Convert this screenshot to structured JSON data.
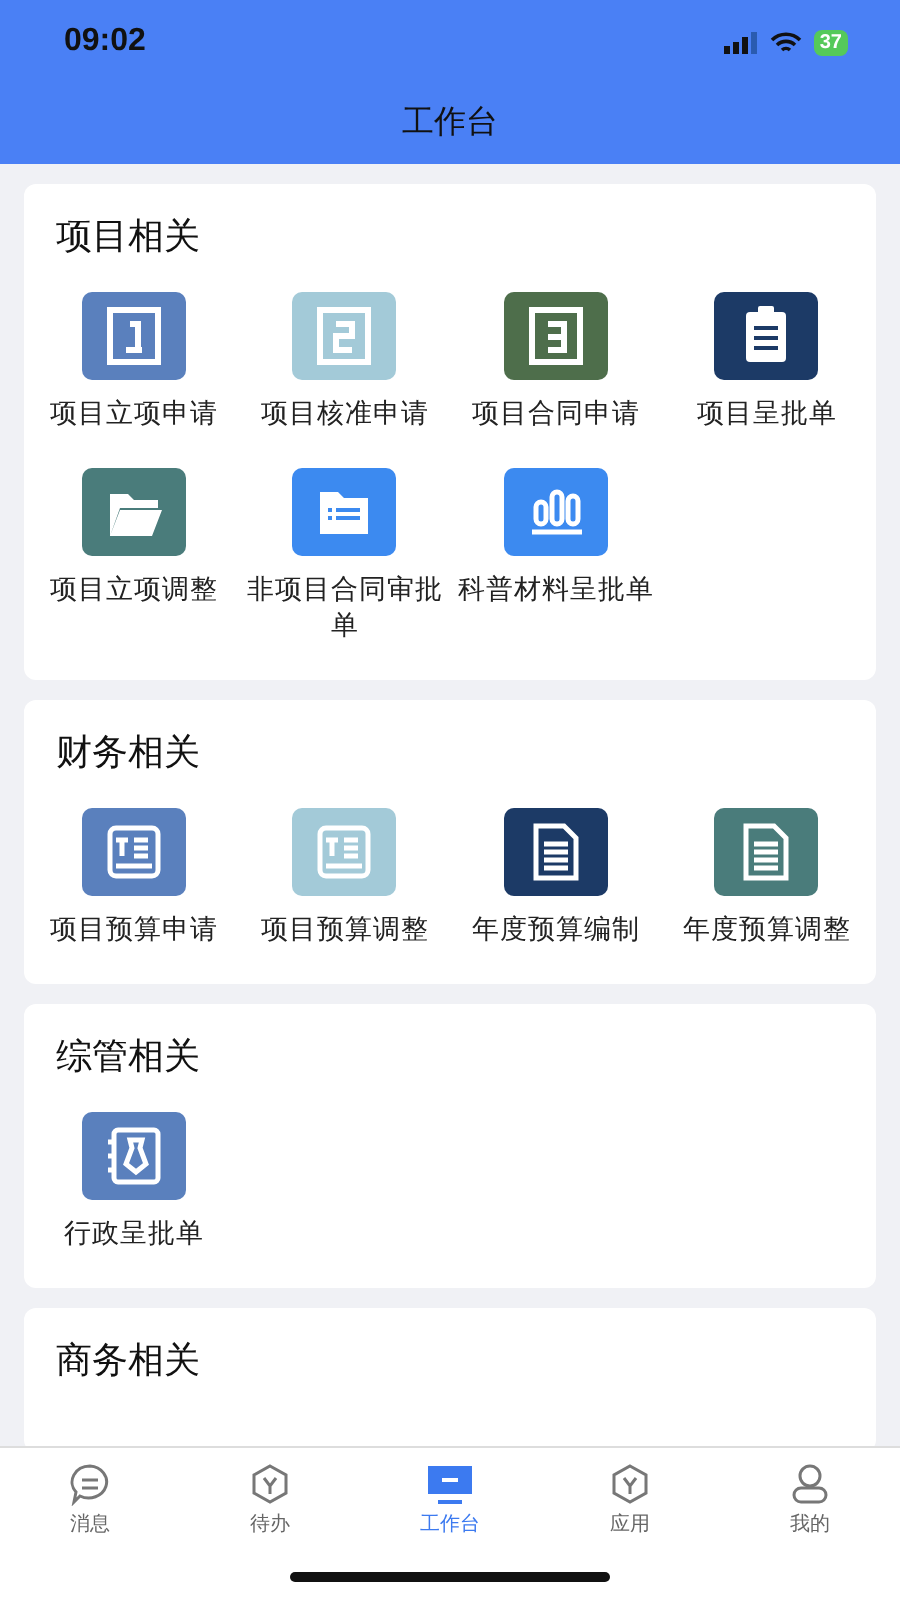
{
  "status_bar": {
    "time": "09:02",
    "battery": "37"
  },
  "title": "工作台",
  "sections": [
    {
      "title": "项目相关",
      "items": [
        {
          "label": "项目立项申请",
          "kind": "num1",
          "color": "#5a80bd"
        },
        {
          "label": "项目核准申请",
          "kind": "num2",
          "color": "#a3cad8"
        },
        {
          "label": "项目合同申请",
          "kind": "num3",
          "color": "#4e6e4b"
        },
        {
          "label": "项目呈批单",
          "kind": "clipboard",
          "color": "#1c3a66"
        },
        {
          "label": "项目立项调整",
          "kind": "folder",
          "color": "#4a7c7b"
        },
        {
          "label": "非项目合同审批单",
          "kind": "listfolder",
          "color": "#3c8af0"
        },
        {
          "label": "科普材料呈批单",
          "kind": "bars",
          "color": "#3c8af0"
        }
      ]
    },
    {
      "title": "财务相关",
      "items": [
        {
          "label": "项目预算申请",
          "kind": "budget",
          "color": "#5a80bd"
        },
        {
          "label": "项目预算调整",
          "kind": "budget",
          "color": "#a3cad8"
        },
        {
          "label": "年度预算编制",
          "kind": "doc",
          "color": "#1c3a66"
        },
        {
          "label": "年度预算调整",
          "kind": "doc",
          "color": "#4a7c7b"
        }
      ]
    },
    {
      "title": "综管相关",
      "items": [
        {
          "label": "行政呈批单",
          "kind": "badge",
          "color": "#5a80bd"
        }
      ]
    },
    {
      "title": "商务相关"
    }
  ],
  "tabs": [
    {
      "label": "消息",
      "kind": "chat",
      "selected": false
    },
    {
      "label": "待办",
      "kind": "cube",
      "selected": false
    },
    {
      "label": "工作台",
      "kind": "monitor",
      "selected": true
    },
    {
      "label": "应用",
      "kind": "cube",
      "selected": false
    },
    {
      "label": "我的",
      "kind": "person",
      "selected": false
    }
  ]
}
